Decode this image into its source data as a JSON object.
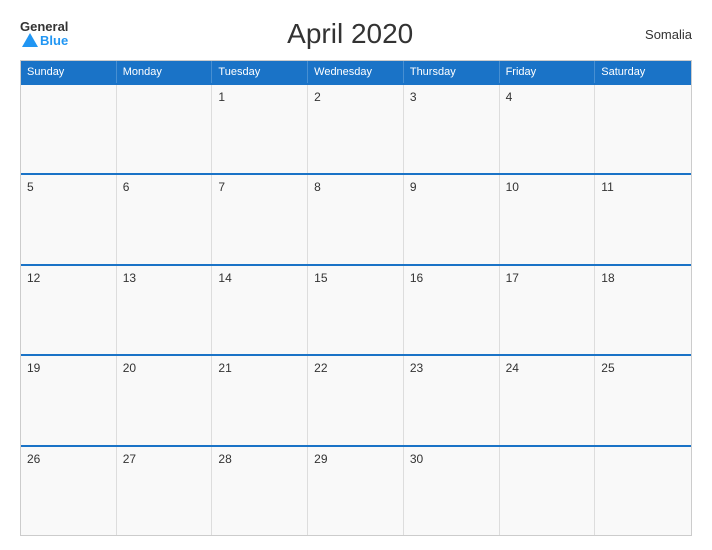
{
  "header": {
    "title": "April 2020",
    "country": "Somalia",
    "logo_general": "General",
    "logo_blue": "Blue"
  },
  "calendar": {
    "days_of_week": [
      "Sunday",
      "Monday",
      "Tuesday",
      "Wednesday",
      "Thursday",
      "Friday",
      "Saturday"
    ],
    "weeks": [
      [
        {
          "day": "",
          "empty": true
        },
        {
          "day": "",
          "empty": true
        },
        {
          "day": "1",
          "empty": false
        },
        {
          "day": "2",
          "empty": false
        },
        {
          "day": "3",
          "empty": false
        },
        {
          "day": "4",
          "empty": false
        },
        {
          "day": "",
          "empty": true
        }
      ],
      [
        {
          "day": "5",
          "empty": false
        },
        {
          "day": "6",
          "empty": false
        },
        {
          "day": "7",
          "empty": false
        },
        {
          "day": "8",
          "empty": false
        },
        {
          "day": "9",
          "empty": false
        },
        {
          "day": "10",
          "empty": false
        },
        {
          "day": "11",
          "empty": false
        }
      ],
      [
        {
          "day": "12",
          "empty": false
        },
        {
          "day": "13",
          "empty": false
        },
        {
          "day": "14",
          "empty": false
        },
        {
          "day": "15",
          "empty": false
        },
        {
          "day": "16",
          "empty": false
        },
        {
          "day": "17",
          "empty": false
        },
        {
          "day": "18",
          "empty": false
        }
      ],
      [
        {
          "day": "19",
          "empty": false
        },
        {
          "day": "20",
          "empty": false
        },
        {
          "day": "21",
          "empty": false
        },
        {
          "day": "22",
          "empty": false
        },
        {
          "day": "23",
          "empty": false
        },
        {
          "day": "24",
          "empty": false
        },
        {
          "day": "25",
          "empty": false
        }
      ],
      [
        {
          "day": "26",
          "empty": false
        },
        {
          "day": "27",
          "empty": false
        },
        {
          "day": "28",
          "empty": false
        },
        {
          "day": "29",
          "empty": false
        },
        {
          "day": "30",
          "empty": false
        },
        {
          "day": "",
          "empty": true
        },
        {
          "day": "",
          "empty": true
        }
      ]
    ]
  }
}
